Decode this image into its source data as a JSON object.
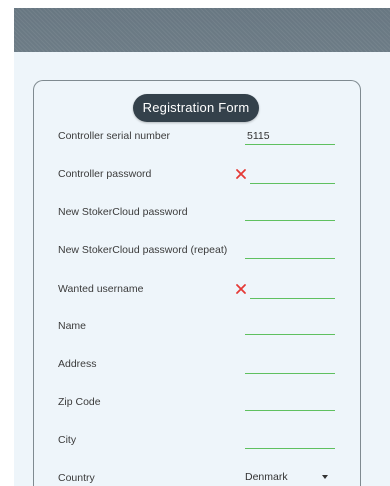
{
  "form": {
    "title": "Registration Form",
    "fields": [
      {
        "label": "Controller serial number",
        "value": "5115",
        "error": false
      },
      {
        "label": "Controller password",
        "value": "",
        "error": true
      },
      {
        "label": "New StokerCloud password",
        "value": "",
        "error": false
      },
      {
        "label": "New StokerCloud password (repeat)",
        "value": "",
        "error": false
      },
      {
        "label": "Wanted username",
        "value": "",
        "error": true
      },
      {
        "label": "Name",
        "value": "",
        "error": false
      },
      {
        "label": "Address",
        "value": "",
        "error": false
      },
      {
        "label": "Zip Code",
        "value": "",
        "error": false
      },
      {
        "label": "City",
        "value": "",
        "error": false
      }
    ],
    "country": {
      "label": "Country",
      "selected": "Denmark"
    }
  },
  "icons": {
    "error": "close-icon",
    "dropdown": "chevron-down-icon"
  },
  "colors": {
    "header": "#6b7a84",
    "background": "#eef5fa",
    "title_pill": "#34414b",
    "input_underline": "#5fc05f",
    "error": "#e53935"
  }
}
